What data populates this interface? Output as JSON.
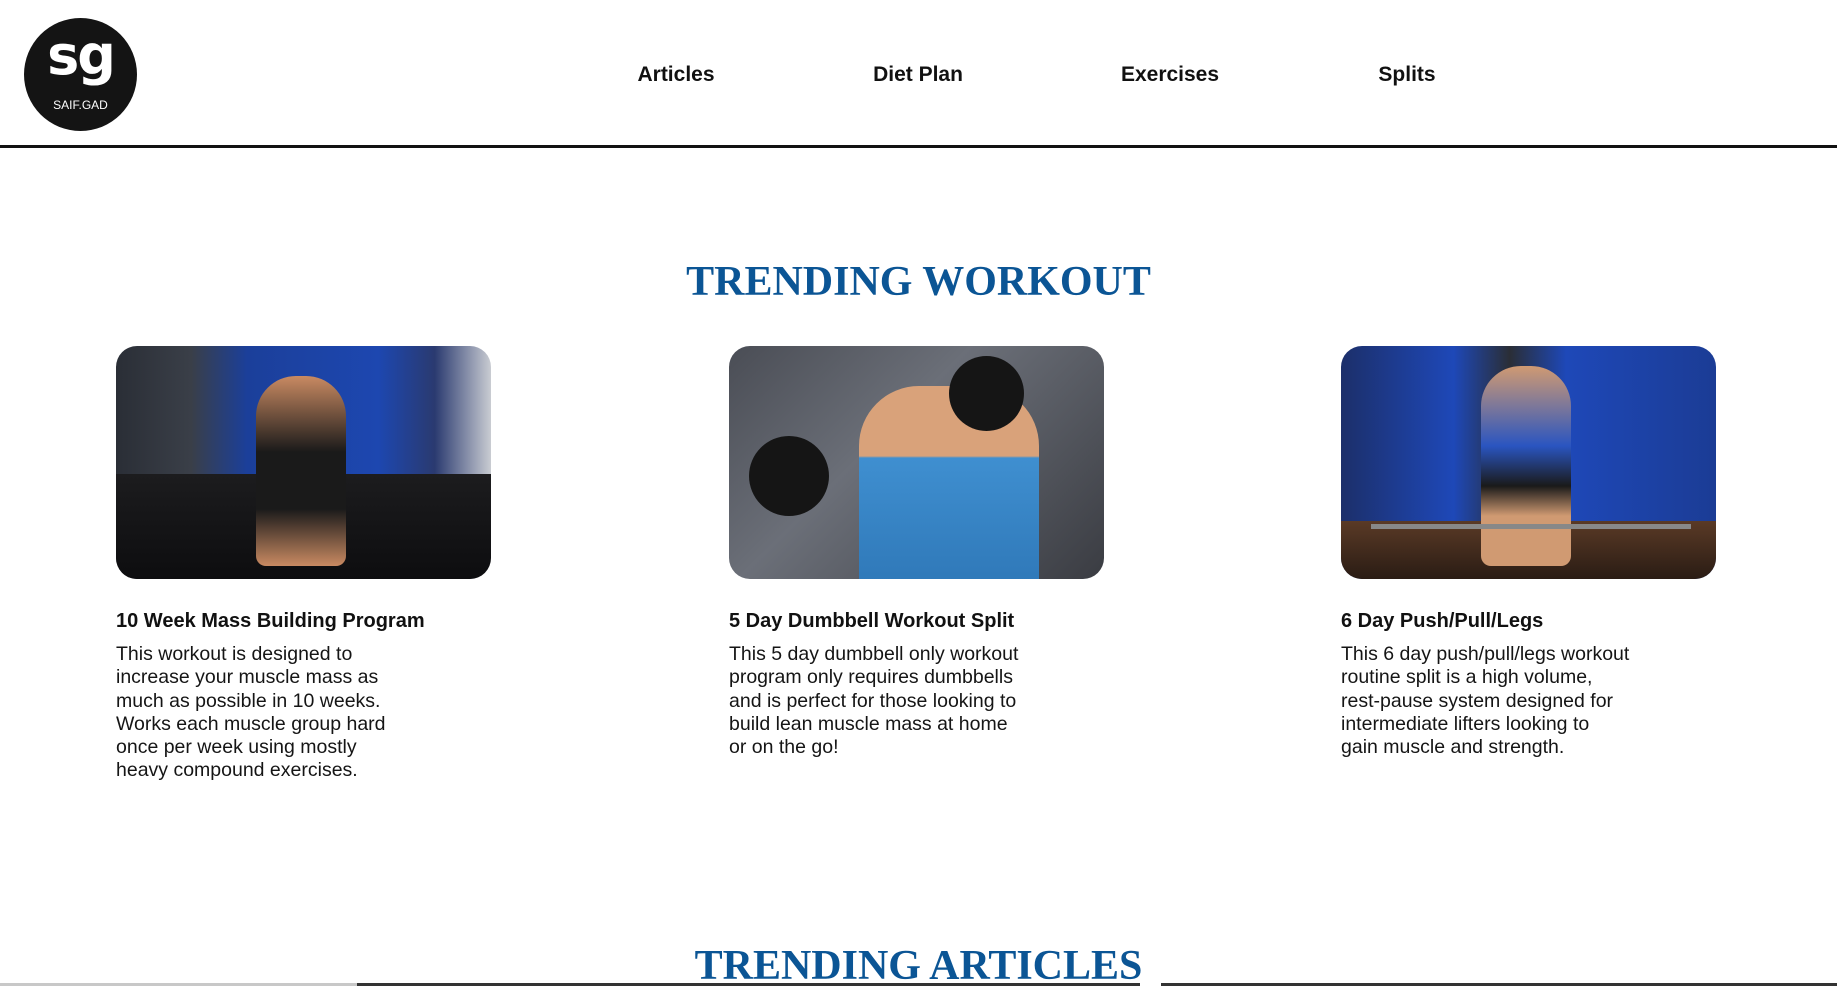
{
  "logo": {
    "mark": "sg",
    "name": "SAIF.GAD"
  },
  "nav": {
    "items": [
      "Articles",
      "Diet Plan",
      "Exercises",
      "Splits"
    ]
  },
  "trending_workout": {
    "title": "TRENDING WORKOUT",
    "cards": [
      {
        "title": "10 Week Mass Building Program",
        "description": "This workout is designed to increase your muscle mass as much as possible in 10 weeks. Works each muscle group hard once per week using mostly heavy compound exercises."
      },
      {
        "title": "5 Day Dumbbell Workout Split",
        "description": "This 5 day dumbbell only workout program only requires dumbbells and is perfect for those looking to build lean muscle mass at home or on the go!"
      },
      {
        "title": "6 Day Push/Pull/Legs",
        "description": "This 6 day push/pull/legs workout routine split is a high volume, rest-pause system designed for intermediate lifters looking to gain muscle and strength."
      }
    ]
  },
  "trending_articles": {
    "title": "TRENDING ARTICLES"
  },
  "colors": {
    "accent": "#0b5595"
  }
}
